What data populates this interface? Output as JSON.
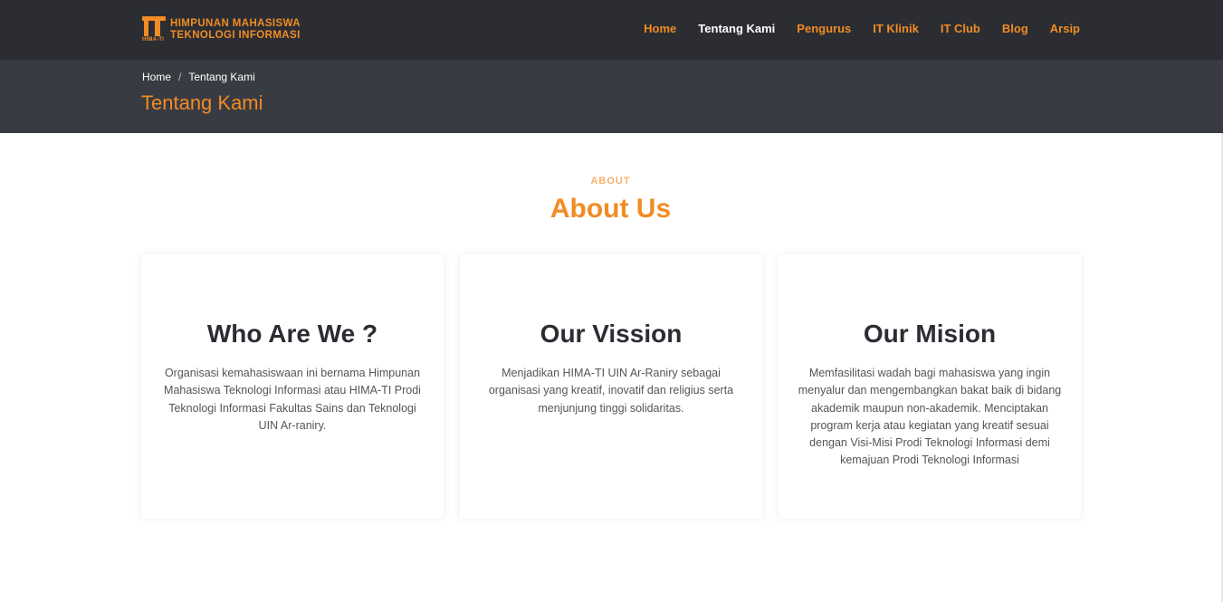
{
  "brand": {
    "mark": "IT",
    "mark_sub": "HIMA-TI",
    "line1": "HIMPUNAN MAHASISWA",
    "line2": "TEKNOLOGI INFORMASI",
    "color": "#f08c23"
  },
  "nav": {
    "items": [
      {
        "label": "Home",
        "active": false
      },
      {
        "label": "Tentang Kami",
        "active": true
      },
      {
        "label": "Pengurus",
        "active": false
      },
      {
        "label": "IT Klinik",
        "active": false
      },
      {
        "label": "IT Club",
        "active": false
      },
      {
        "label": "Blog",
        "active": false
      },
      {
        "label": "Arsip",
        "active": false
      }
    ]
  },
  "breadcrumb": {
    "home": "Home",
    "separator": "/",
    "current": "Tentang Kami"
  },
  "page_title": "Tentang Kami",
  "section": {
    "tag": "ABOUT",
    "title": "About Us"
  },
  "cards": [
    {
      "title": "Who Are We ?",
      "text": "Organisasi kemahasiswaan ini bernama Himpunan Mahasiswa Teknologi Informasi atau HIMA-TI Prodi Teknologi Informasi Fakultas Sains dan Teknologi UIN Ar-raniry."
    },
    {
      "title": "Our Vission",
      "text": "Menjadikan HIMA-TI UIN Ar-Raniry sebagai organisasi yang kreatif, inovatif dan religius serta menjunjung tinggi solidaritas."
    },
    {
      "title": "Our Mision",
      "text": "Memfasilitasi wadah bagi mahasiswa yang ingin menyalur dan mengembangkan bakat baik di bidang akademik maupun non-akademik. Menciptakan program kerja atau kegiatan yang kreatif sesuai dengan Visi-Misi Prodi Teknologi Informasi demi kemajuan Prodi Teknologi Informasi"
    }
  ],
  "colors": {
    "accent": "#f08c23",
    "topbar": "#2b2d33",
    "page_header": "#393b42"
  }
}
